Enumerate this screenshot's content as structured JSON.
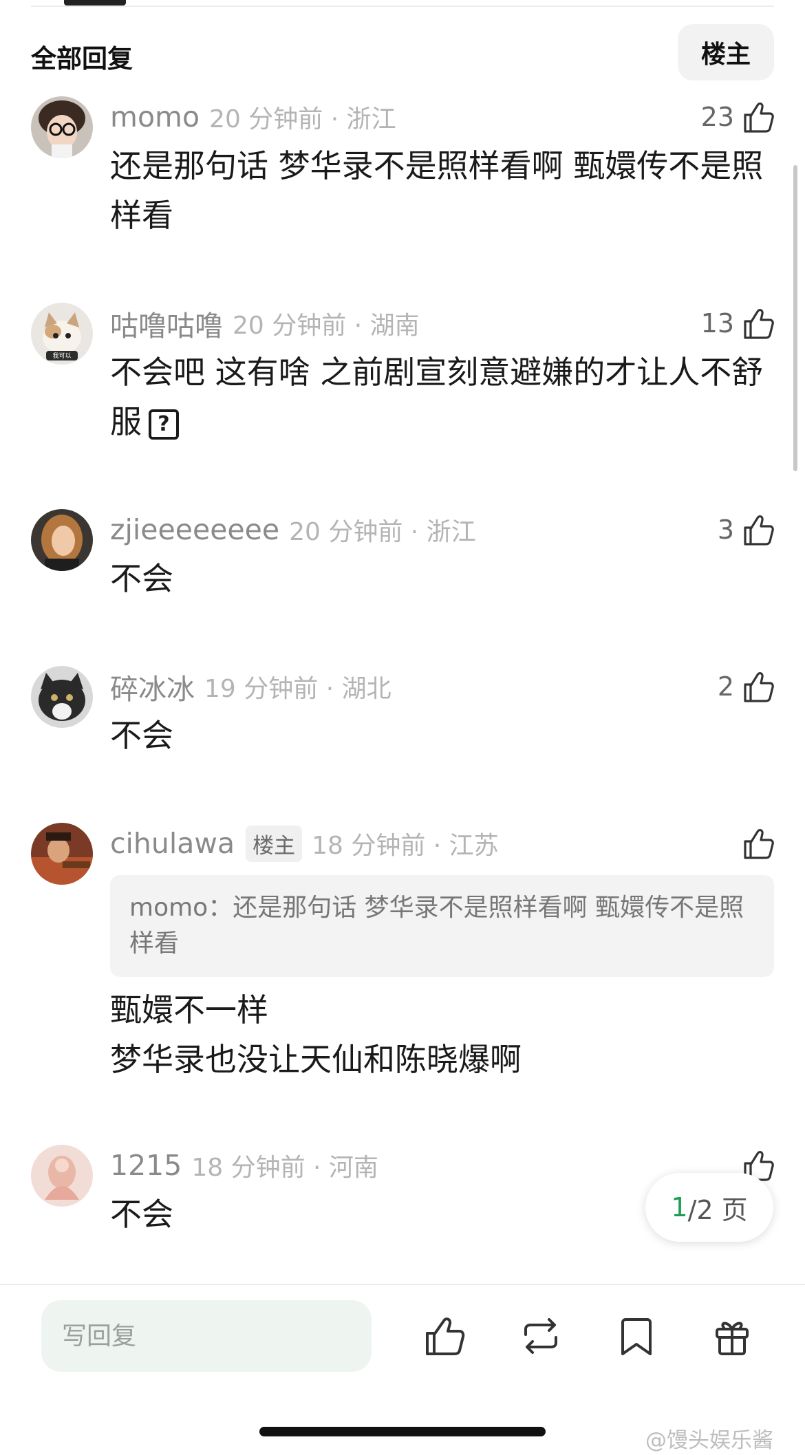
{
  "header": {
    "title": "全部回复",
    "op_filter_label": "楼主"
  },
  "comments": [
    {
      "username": "momo",
      "time_location": "20 分钟前 · 浙江",
      "likes": "23",
      "text": "还是那句话 梦华录不是照样看啊 甄嬛传不是照样看"
    },
    {
      "username": "咕噜咕噜",
      "time_location": "20 分钟前 · 湖南",
      "likes": "13",
      "text": "不会吧 这有啥 之前剧宣刻意避嫌的才让人不舒服",
      "emoji": "?"
    },
    {
      "username": "zjieeeeeeee",
      "time_location": "20 分钟前 · 浙江",
      "likes": "3",
      "text": "不会"
    },
    {
      "username": "碎冰冰",
      "time_location": "19 分钟前 · 湖北",
      "likes": "2",
      "text": "不会"
    },
    {
      "username": "cihulawa",
      "badge": "楼主",
      "time_location": "18 分钟前 · 江苏",
      "likes": "",
      "quote": "momo：还是那句话 梦华录不是照样看啊 甄嬛传不是照样看",
      "text_lines": [
        "甄嬛不一样",
        "梦华录也没让天仙和陈晓爆啊"
      ]
    },
    {
      "username": "1215",
      "time_location": "18 分钟前 · 河南",
      "likes": "",
      "text": "不会"
    }
  ],
  "avatar_labels": {
    "c2": "我可以"
  },
  "pagination": {
    "current": "1",
    "rest": "/2 页"
  },
  "reply_bar": {
    "placeholder": "写回复"
  },
  "icons": [
    "thumb-up-icon",
    "repost-icon",
    "bookmark-icon",
    "gift-icon"
  ],
  "watermark": "@馒头娱乐酱",
  "colors": {
    "accent_green": "#1f9d55",
    "reply_bg": "#eef5f1"
  }
}
